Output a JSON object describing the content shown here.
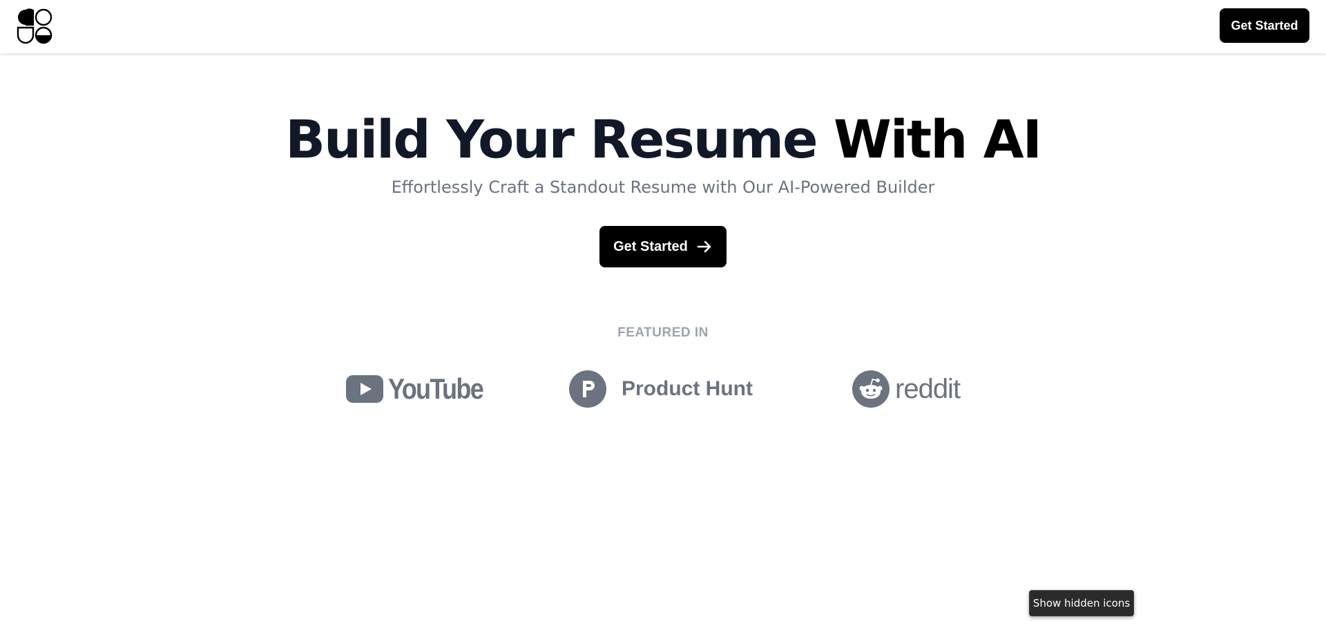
{
  "header": {
    "logo_icon": "four-petal-logo-icon",
    "cta_label": "Get Started"
  },
  "hero": {
    "title_part1": "Build Your Resume",
    "title_part2": "With AI",
    "subtitle": "Effortlessly Craft a Standout Resume with Our AI-Powered Builder",
    "cta_label": "Get Started",
    "cta_icon": "arrow-right-icon"
  },
  "featured": {
    "label": "FEATURED IN",
    "brands": [
      {
        "name": "YouTube",
        "text": "YouTube",
        "icon": "youtube-icon"
      },
      {
        "name": "Product Hunt",
        "text": "Product Hunt",
        "icon": "product-hunt-icon",
        "icon_letter": "P"
      },
      {
        "name": "reddit",
        "text": "reddit",
        "icon": "reddit-icon"
      }
    ]
  },
  "tooltip": {
    "text": "Show hidden icons"
  },
  "colors": {
    "primary": "#000000",
    "title": "#111827",
    "muted": "#6b7280",
    "label": "#9ca3af"
  }
}
